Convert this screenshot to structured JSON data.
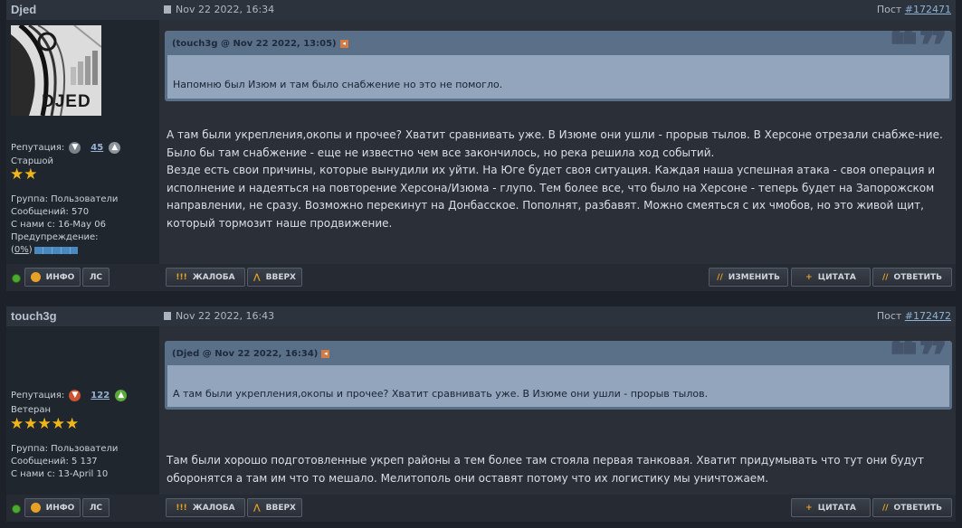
{
  "posts": [
    {
      "author": "Djed",
      "date": "Nov 22 2022, 16:34",
      "post_label": "Пост",
      "post_number": "#172471",
      "avatar_text": "DJED",
      "reputation_label": "Репутация:",
      "reputation_value": "45",
      "rank": "Старшой",
      "stars": "★★",
      "group": "Группа: Пользователи",
      "messages": "Сообщений: 570",
      "since": "С нами с: 16-May 06",
      "warning_label": "Предупреждение:",
      "warning_pct": "0%",
      "quote_header": "(touch3g @ Nov 22 2022, 13:05)",
      "quote_text": "Напомню был Изюм и там было снабжение но это не помогло.",
      "message_paragraphs": [
        "А там были укрепления,окопы и прочее? Хватит сравнивать уже. В Изюме они ушли - прорыв тылов. В Херсоне отрезали снабже-ние.",
        "Было бы там снабжение - еще не известно чем все закончилось, но река решила ход событий.",
        "Везде есть свои причины, которые вынудили их уйти. На Юге будет своя ситуация. Каждая наша успешная атака - своя операция и исполнение и надеяться на повторение Херсона/Изюма - глупо. Тем более все, что было на Херсоне - теперь будет на Запорожском направлении, не сразу. Возможно перекинут на Донбасское. Пополнят, разбавят. Можно смеяться с их чмобов, но это живой щит, который тормозит наше продвижение."
      ],
      "buttons": {
        "info": "ИНФО",
        "pm": "ЛС",
        "report": "ЖАЛОБА",
        "up": "ВВЕРХ",
        "edit": "ИЗМЕНИТЬ",
        "quote": "ЦИТАТА",
        "reply": "ОТВЕТИТЬ"
      }
    },
    {
      "author": "touch3g",
      "date": "Nov 22 2022, 16:43",
      "post_label": "Пост",
      "post_number": "#172472",
      "reputation_label": "Репутация:",
      "reputation_value": "122",
      "rank": "Ветеран",
      "stars": "★★★★★",
      "group": "Группа: Пользователи",
      "messages": "Сообщений: 5 137",
      "since": "С нами с: 13-April 10",
      "quote_header": "(Djed @ Nov 22 2022, 16:34)",
      "quote_text": "А там были укрепления,окопы и прочее? Хватит сравнивать уже. В Изюме они ушли - прорыв тылов.",
      "message_paragraphs": [
        "Там были хорошо подготовленные укреп районы а тем более там стояла первая танковая. Хватит придумывать что тут они будут оборонятся а там им что то мешало. Мелитополь они оставят потому что их логистику мы уничтожаем."
      ],
      "buttons": {
        "info": "ИНФО",
        "pm": "ЛС",
        "report": "ЖАЛОБА",
        "up": "ВВЕРХ",
        "quote": "ЦИТАТА",
        "reply": "ОТВЕТИТЬ"
      }
    }
  ],
  "icons": {
    "doc": "document-icon",
    "rep_down": "thumb-down-icon",
    "rep_up": "thumb-up-icon",
    "online": "online-status-icon",
    "back": "back-to-quote-icon",
    "quote_marks": "quote-marks-icon"
  },
  "colors": {
    "page_bg": "#1d222a",
    "quote_bg": "#93a5bd",
    "accent": "#e7a126",
    "link": "#8fb1d4",
    "star": "#f0b51b"
  }
}
